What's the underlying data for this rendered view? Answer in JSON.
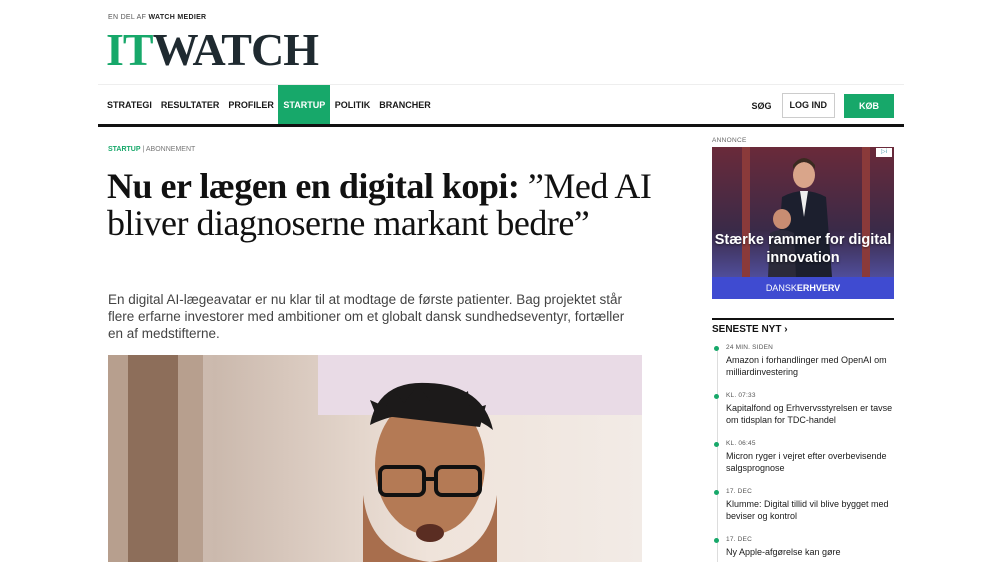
{
  "header": {
    "tagline_prefix": "EN DEL AF",
    "tagline_brand": "WATCH MEDIER",
    "logo_it": "IT",
    "logo_watch": "WATCH"
  },
  "nav": {
    "items": [
      "STRATEGI",
      "RESULTATER",
      "PROFILER",
      "STARTUP",
      "POLITIK",
      "BRANCHER"
    ],
    "active": "STARTUP",
    "search_label": "SØG",
    "login_label": "LOG IND",
    "buy_label": "KØB"
  },
  "article": {
    "section": "STARTUP",
    "separator": "|",
    "subscription": "ABONNEMENT",
    "headline_bold": "Nu er lægen en digital kopi:",
    "headline_rest": " ”Med AI bliver diagnoserne markant bedre”",
    "lead": "En digital AI-lægeavatar er nu klar til at modtage de første patienter. Bag projektet står flere erfarne investorer med ambitioner om et globalt dansk sundhedseventyr, fortæller en af medstifterne."
  },
  "ad": {
    "label": "ANNONCE",
    "text": "Stærke rammer for digital innovation",
    "brand_a": "DANSK",
    "brand_b": "ERHVERV"
  },
  "latest": {
    "title": "SENESTE NYT",
    "arrow": "›",
    "items": [
      {
        "time": "24 MIN. SIDEN",
        "headline": "Amazon i forhandlinger med OpenAI om milliardinvestering"
      },
      {
        "time": "KL. 07:33",
        "headline": "Kapitalfond og Erhvervsstyrelsen er tavse om tidsplan for TDC-handel"
      },
      {
        "time": "KL. 06:45",
        "headline": "Micron ryger i vejret efter overbevisende salgsprognose"
      },
      {
        "time": "17. DEC",
        "headline": "Klumme: Digital tillid vil blive bygget med beviser og kontrol"
      },
      {
        "time": "17. DEC",
        "headline": "Ny Apple-afgørelse kan gøre"
      }
    ]
  },
  "colors": {
    "accent": "#17a86a",
    "logo_dark": "#1f2a30"
  }
}
